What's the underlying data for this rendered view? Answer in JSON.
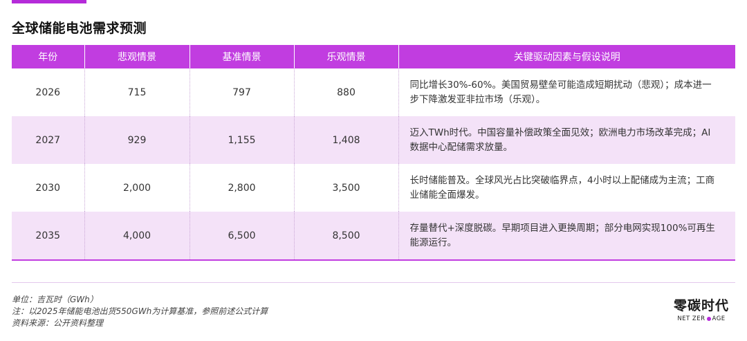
{
  "title": "全球储能电池需求预测",
  "table": {
    "headers": [
      "年份",
      "悲观情景",
      "基准情景",
      "乐观情景",
      "关键驱动因素与假设说明"
    ],
    "rows": [
      {
        "year": "2026",
        "pessimistic": "715",
        "baseline": "797",
        "optimistic": "880",
        "notes_lines": [
          "同比增长30%-60%。美国贸易壁垒可能造成短期扰动（悲观）；成本进一",
          "步下降激发亚非拉市场（乐观）。"
        ]
      },
      {
        "year": "2027",
        "pessimistic": "929",
        "baseline": "1,155",
        "optimistic": "1,408",
        "notes_lines": [
          "迈入TWh时代。中国容量补偿政策全面见效；欧洲电力市场改革完成；AI",
          "数据中心配储需求放量。"
        ]
      },
      {
        "year": "2030",
        "pessimistic": "2,000",
        "baseline": "2,800",
        "optimistic": "3,500",
        "notes_lines": [
          "长时储能普及。全球风光占比突破临界点，4小时以上配储成为主流；工商",
          "业储能全面爆发。"
        ]
      },
      {
        "year": "2035",
        "pessimistic": "4,000",
        "baseline": "6,500",
        "optimistic": "8,500",
        "notes_lines": [
          "存量替代+深度脱碳。早期项目进入更换周期；部分电网实现100%可再生",
          "能源运行。"
        ]
      }
    ]
  },
  "footnotes": [
    "单位：吉瓦时（GWh）",
    "注：以2025年储能电池出货550GWh为计算基准，参照前述公式计算",
    "资料来源：公开资料整理"
  ],
  "brand": {
    "name_cn": "零碳时代",
    "name_en_left": "NET ZER",
    "name_en_right": "AGE"
  },
  "colors": {
    "accent": "#c13de0",
    "row_shade": "#f4e2f8"
  }
}
